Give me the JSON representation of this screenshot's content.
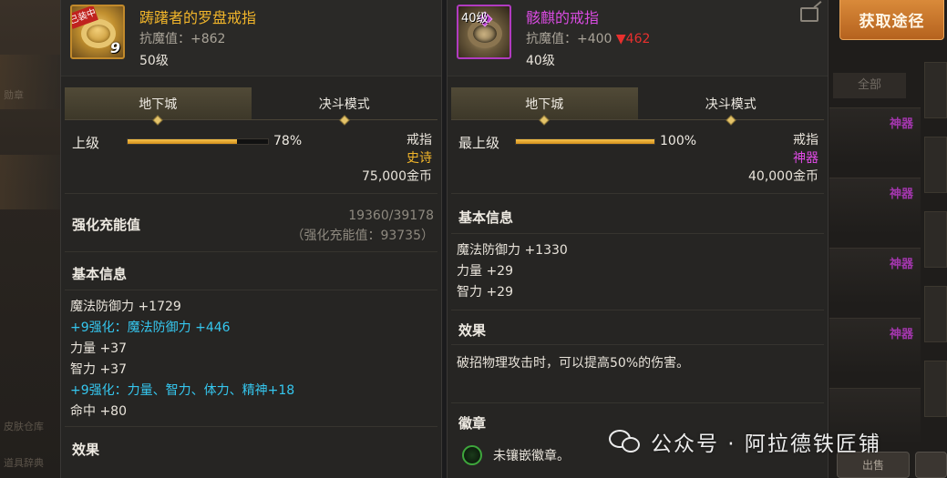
{
  "left_item": {
    "badge": "已装中",
    "icon_count": "9",
    "name": "踌躇者的罗盘戒指",
    "stat": "抗魔值：+862",
    "level": "50级",
    "tabs": [
      "地下城",
      "决斗模式"
    ],
    "grade": {
      "label": "上级",
      "percent_text": "78%",
      "percent": 78
    },
    "slot": "戒指",
    "rarity": "史诗",
    "price": "75,000金币",
    "charge": {
      "title": "强化充能值",
      "progress": "19360/39178",
      "total": "（强化充能值：93735）"
    },
    "basic_title": "基本信息",
    "attributes": [
      {
        "text": "魔法防御力 +1729",
        "color": "normal"
      },
      {
        "text": "+9强化：魔法防御力 +446",
        "color": "cyan"
      },
      {
        "text": "力量 +37",
        "color": "normal"
      },
      {
        "text": "智力 +37",
        "color": "normal"
      },
      {
        "text": "+9强化：力量、智力、体力、精神+18",
        "color": "cyan"
      },
      {
        "text": "命中 +80",
        "color": "normal"
      }
    ],
    "effect_title": "效果"
  },
  "right_item": {
    "icon_level": "40级",
    "name": "骸麒的戒指",
    "stat_prefix": "抗魔值：+400 ",
    "stat_down": "▼462",
    "level": "40级",
    "tabs": [
      "地下城",
      "决斗模式"
    ],
    "grade": {
      "label": "最上级",
      "percent_text": "100%",
      "percent": 100
    },
    "slot": "戒指",
    "rarity": "神器",
    "price": "40,000金币",
    "basic_title": "基本信息",
    "attributes": [
      "魔法防御力 +1330",
      "力量 +29",
      "智力 +29"
    ],
    "effect_title": "效果",
    "effect_text": "破招物理攻击时，可以提高50%的伤害。",
    "badge_title": "徽章",
    "badge_text": "未镶嵌徽章。"
  },
  "sidebar": {
    "obtain_button": "获取途径",
    "filter_all": "全部",
    "rarity_tags": [
      "神器",
      "神器",
      "神器",
      "神器"
    ],
    "sell_button": "出售"
  },
  "background_left": [
    "勋章",
    "皮肤仓库",
    "道具辞典"
  ],
  "watermark": "公众号 · 阿拉德铁匠铺",
  "colors": {
    "epic": "#f1b52a",
    "myth": "#e24be8",
    "enhance": "#35c7ef",
    "down": "#e8302e",
    "obtain": "#c97728"
  }
}
